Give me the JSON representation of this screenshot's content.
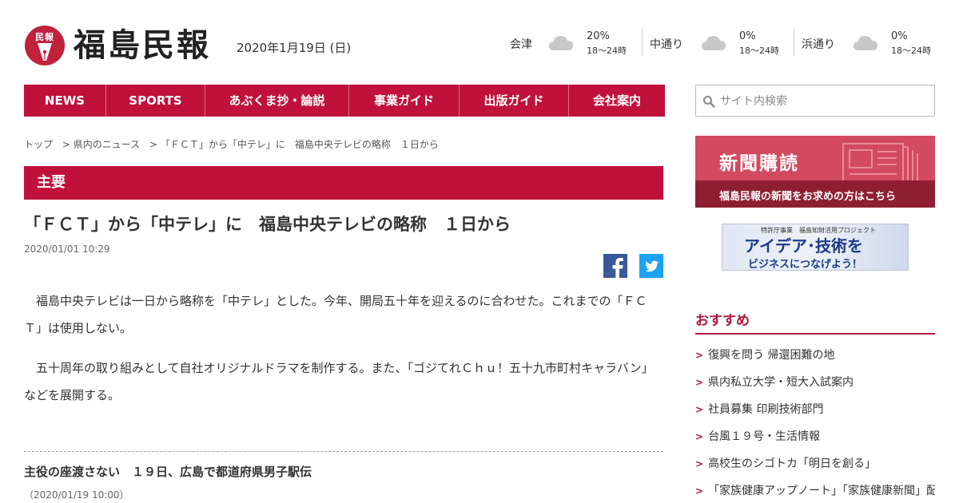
{
  "header": {
    "logo_mark_text": "民報",
    "logo_title": "福島民報",
    "date": "2020年1月19日 (日)"
  },
  "weather": [
    {
      "region": "会津",
      "pct": "20%",
      "temp": "18～24時",
      "icon": "cloud-icon"
    },
    {
      "region": "中通り",
      "pct": "0%",
      "temp": "18～24時",
      "icon": "cloud-icon"
    },
    {
      "region": "浜通り",
      "pct": "0%",
      "temp": "18～24時",
      "icon": "cloud-icon"
    }
  ],
  "nav": [
    {
      "label": "NEWS"
    },
    {
      "label": "SPORTS"
    },
    {
      "label": "あぶくま抄・論説"
    },
    {
      "label": "事業ガイド"
    },
    {
      "label": "出版ガイド"
    },
    {
      "label": "会社案内"
    }
  ],
  "search": {
    "placeholder": "サイト内検索"
  },
  "breadcrumb": [
    "トップ",
    "> 県内のニュース",
    "> 「ＦＣＴ」から「中テレ」に　福島中央テレビの略称　１日から"
  ],
  "section": {
    "label": "主要"
  },
  "article": {
    "title": "「ＦＣＴ」から「中テレ」に　福島中央テレビの略称　１日から",
    "date": "2020/01/01 10:29",
    "paragraphs": [
      "福島中央テレビは一日から略称を「中テレ」とした。今年、開局五十年を迎えるのに合わせた。これまでの「ＦＣＴ」は使用しない。",
      "五十周年の取り組みとして自社オリジナルドラマを制作する。また、「ゴジてれＣｈｕ！五十九市町村キャラバン」などを展開する。"
    ]
  },
  "related": {
    "title": "主役の座渡さない　１９日、広島で都道府県男子駅伝",
    "date": "（2020/01/19 10:00）"
  },
  "sidebar": {
    "subscribe_title": "新聞購読",
    "subscribe_sub": "福島民報の新聞をお求めの方はこちら",
    "idea_top": "特許庁事業　福島知財活用プロジェクト",
    "idea_main": "アイデア･技術を",
    "idea_sub": "ビジネスにつなげよう！",
    "reco_heading": "おすすめ",
    "reco_items": [
      "復興を問う 帰還困難の地",
      "県内私立大学・短大入試案内",
      "社員募集 印刷技術部門",
      "台風１９号・生活情報",
      "高校生のシゴトカ「明日を創る」",
      "「家族健康アップノート」「家族健康新聞」配…"
    ]
  },
  "colors": {
    "brand": "#c0113c",
    "accent_dark": "#8e1f33",
    "facebook": "#3b5998",
    "twitter": "#1da1f2"
  }
}
